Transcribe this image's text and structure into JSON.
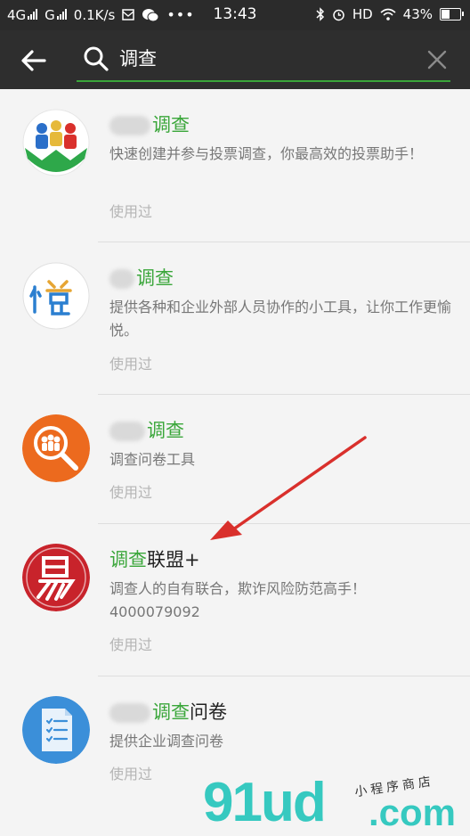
{
  "status_bar": {
    "network1": "4G",
    "network2": "G",
    "speed": "0.1K/s",
    "time": "13:43",
    "hd": "HD",
    "battery": "43%"
  },
  "search": {
    "query": "调查"
  },
  "results": [
    {
      "title_prefix": "",
      "title_highlight": "调查",
      "title_suffix": "",
      "desc": "快速创建并参与投票调查，你最高效的投票助手！",
      "phone": "",
      "used": "使用过",
      "logo_icon": "people-chart-logo"
    },
    {
      "title_prefix": "",
      "title_highlight": "调查",
      "title_suffix": "",
      "desc": "提供各种和企业外部人员协作的小工具，让你工作更愉悦。",
      "phone": "",
      "used": "使用过",
      "logo_icon": "yue-character-logo"
    },
    {
      "title_prefix": "",
      "title_highlight": "调查",
      "title_suffix": "",
      "desc": "调查问卷工具",
      "phone": "",
      "used": "使用过",
      "logo_icon": "magnifier-people-logo"
    },
    {
      "title_prefix": "",
      "title_highlight": "调查",
      "title_suffix": "联盟+",
      "desc": "调查人的自有联合，欺诈风险防范高手！",
      "phone": "4000079092",
      "used": "使用过",
      "logo_icon": "red-seal-logo"
    },
    {
      "title_prefix": "",
      "title_highlight": "调查",
      "title_suffix": "问卷",
      "desc": "提供企业调查问卷",
      "phone": "",
      "used": "使用过",
      "logo_icon": "checklist-document-logo"
    }
  ],
  "watermark": {
    "main": "91ud",
    "com": ".com",
    "sub": "小程序商店"
  },
  "colors": {
    "highlight": "#3aa63a",
    "header_bg": "#2e2e2e",
    "watermark": "#36c9c0",
    "arrow": "#d9302c"
  }
}
